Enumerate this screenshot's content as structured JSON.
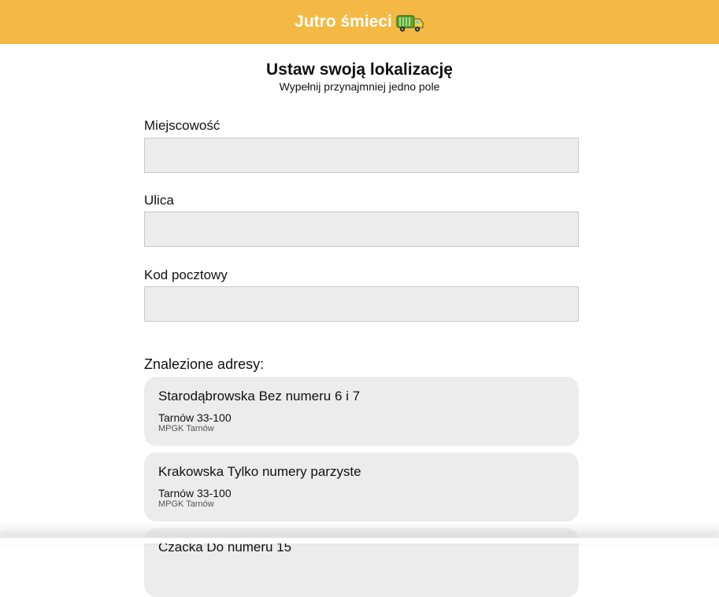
{
  "header": {
    "title": "Jutro śmieci",
    "icon": "garbage-truck-icon",
    "background": "#f4b944"
  },
  "page": {
    "heading": "Ustaw swoją lokalizację",
    "subheading": "Wypełnij przynajmniej jedno pole"
  },
  "form": {
    "city_label": "Miejscowość",
    "city_value": "",
    "street_label": "Ulica",
    "street_value": "",
    "postal_label": "Kod pocztowy",
    "postal_value": ""
  },
  "results": {
    "label": "Znalezione adresy:",
    "items": [
      {
        "street": "Starodąbrowska Bez numeru 6 i 7",
        "city": "Tarnów 33-100",
        "provider": "MPGK Tarnów"
      },
      {
        "street": "Krakowska Tylko numery parzyste",
        "city": "Tarnów 33-100",
        "provider": "MPGK Tarnów"
      },
      {
        "street": "Czacka  Do numeru 15",
        "city": "",
        "provider": ""
      }
    ]
  }
}
